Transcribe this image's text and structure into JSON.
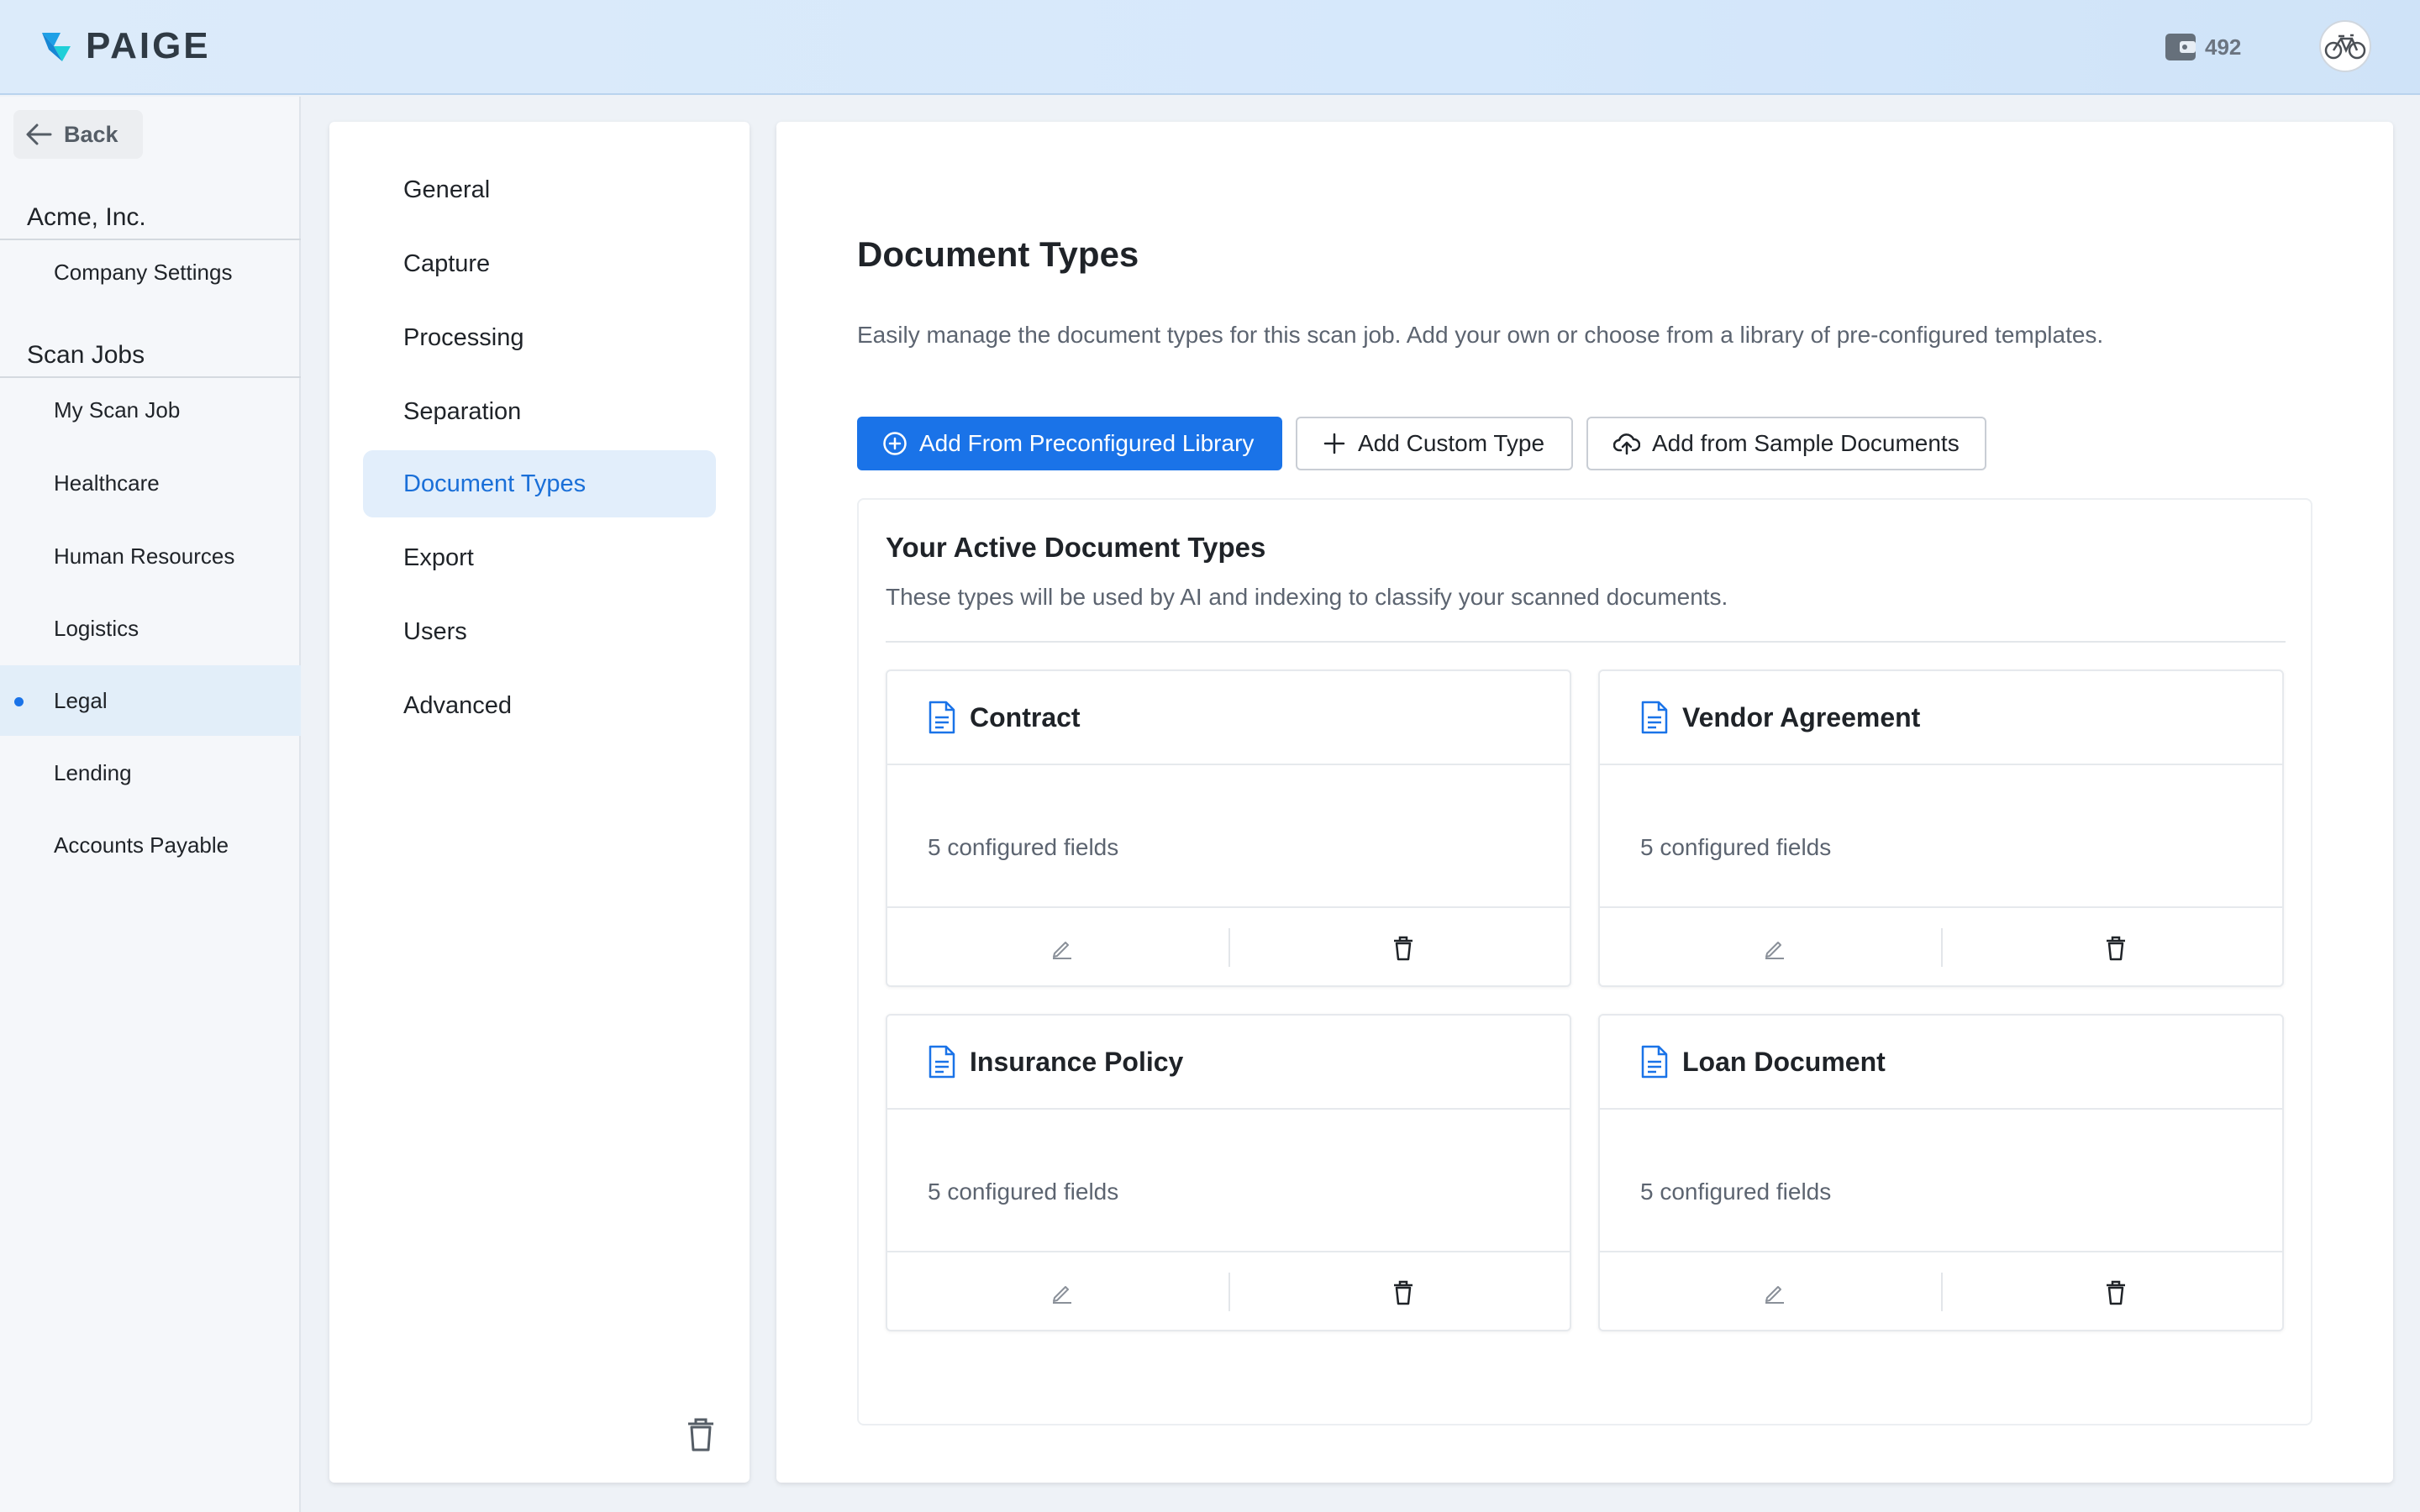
{
  "header": {
    "brand": "PAIGE",
    "credits": "492",
    "colors": {
      "accent": "#1a73e8",
      "logo_primary": "#1ea0e6",
      "logo_secondary": "#1fcfd8"
    }
  },
  "sidebar": {
    "back_label": "Back",
    "company": {
      "name": "Acme, Inc.",
      "items": [
        {
          "label": "Company Settings"
        }
      ]
    },
    "scan_jobs": {
      "title": "Scan Jobs",
      "items": [
        {
          "label": "My Scan Job",
          "active": false
        },
        {
          "label": "Healthcare",
          "active": false
        },
        {
          "label": "Human Resources",
          "active": false
        },
        {
          "label": "Logistics",
          "active": false
        },
        {
          "label": "Legal",
          "active": true
        },
        {
          "label": "Lending",
          "active": false
        },
        {
          "label": "Accounts Payable",
          "active": false
        }
      ]
    }
  },
  "settings_nav": {
    "items": [
      {
        "label": "General",
        "active": false
      },
      {
        "label": "Capture",
        "active": false
      },
      {
        "label": "Processing",
        "active": false
      },
      {
        "label": "Separation",
        "active": false
      },
      {
        "label": "Document Types",
        "active": true
      },
      {
        "label": "Export",
        "active": false
      },
      {
        "label": "Users",
        "active": false
      },
      {
        "label": "Advanced",
        "active": false
      }
    ]
  },
  "main": {
    "title": "Document Types",
    "description": "Easily manage the document types for this scan job. Add your own or choose from a library of pre-configured templates.",
    "buttons": {
      "add_library": "Add From Preconfigured Library",
      "add_custom": "Add Custom Type",
      "add_sample": "Add from Sample Documents"
    },
    "active_types": {
      "title": "Your Active Document Types",
      "description": "These types will be used by AI and indexing to classify your scanned documents.",
      "cards": [
        {
          "name": "Contract",
          "fields": "5 configured fields"
        },
        {
          "name": "Vendor Agreement",
          "fields": "5 configured fields"
        },
        {
          "name": "Insurance Policy",
          "fields": "5 configured fields"
        },
        {
          "name": "Loan Document",
          "fields": "5 configured fields"
        }
      ]
    }
  }
}
